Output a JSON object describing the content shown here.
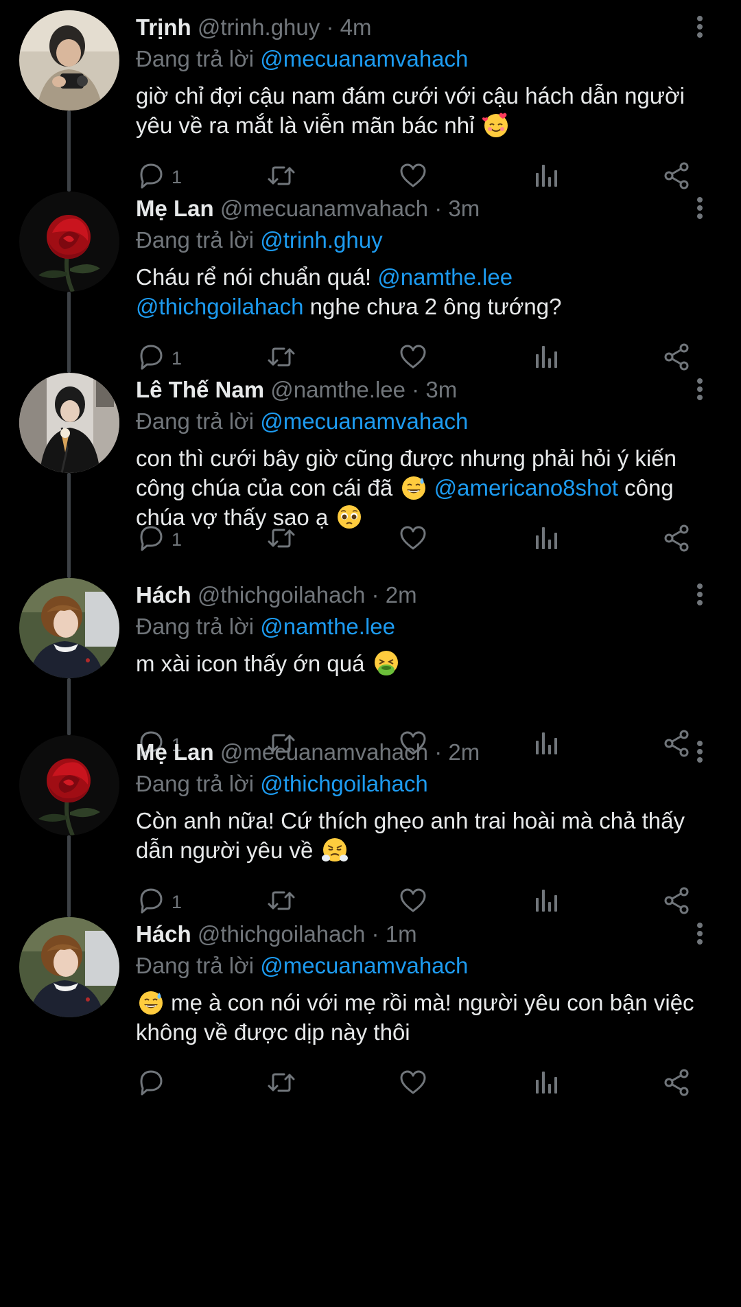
{
  "thread": [
    {
      "name": "Trịnh",
      "handle": "@trinh.ghuy",
      "time": "4m",
      "reply_prefix": "Đang trả lời",
      "reply_to": "@mecuanamvahach",
      "body_parts": [
        {
          "t": "text",
          "v": "giờ chỉ đợi cậu nam đám cưới với cậu hách dẫn người yêu về ra mắt là viễn mãn bác nhỉ "
        },
        {
          "t": "emoji",
          "v": "smiling-face-with-hearts"
        }
      ],
      "reply_count": "1",
      "avatar": "person-with-camera"
    },
    {
      "name": "Mẹ Lan",
      "handle": "@mecuanamvahach",
      "time": "3m",
      "reply_prefix": "Đang trả lời",
      "reply_to": "@trinh.ghuy",
      "body_parts": [
        {
          "t": "text",
          "v": "Cháu rể nói chuẩn quá! "
        },
        {
          "t": "mention",
          "v": "@namthe.lee"
        },
        {
          "t": "br",
          "v": ""
        },
        {
          "t": "mention",
          "v": "@thichgoilahach"
        },
        {
          "t": "text",
          "v": " nghe chưa 2 ông tướng?"
        }
      ],
      "reply_count": "1",
      "avatar": "red-rose"
    },
    {
      "name": "Lê Thế Nam",
      "handle": "@namthe.lee",
      "time": "3m",
      "reply_prefix": "Đang trả lời",
      "reply_to": "@mecuanamvahach",
      "body_parts": [
        {
          "t": "text",
          "v": "con thì cưới bây giờ cũng được nhưng phải hỏi ý kiến công chúa của con cái đã "
        },
        {
          "t": "emoji",
          "v": "grinning-sweat"
        },
        {
          "t": "text",
          "v": " "
        },
        {
          "t": "mention",
          "v": "@americano8shot"
        },
        {
          "t": "text",
          "v": " công chúa vợ thấy sao ạ "
        },
        {
          "t": "emoji",
          "v": "pleading-face"
        }
      ],
      "reply_count": "1",
      "avatar": "person-with-icecream"
    },
    {
      "name": "Hách",
      "handle": "@thichgoilahach",
      "time": "2m",
      "reply_prefix": "Đang trả lời",
      "reply_to": "@namthe.lee",
      "body_parts": [
        {
          "t": "text",
          "v": "m xài icon thấy ớn quá "
        },
        {
          "t": "emoji",
          "v": "vomiting-face"
        }
      ],
      "reply_count": "1",
      "avatar": "person-in-sweater"
    },
    {
      "name": "Mẹ Lan",
      "handle": "@mecuanamvahach",
      "time": "2m",
      "reply_prefix": "Đang trả lời",
      "reply_to": "@thichgoilahach",
      "body_parts": [
        {
          "t": "text",
          "v": "Còn anh nữa! Cứ thích ghẹo anh trai hoài mà chả thấy dẫn người yêu về "
        },
        {
          "t": "emoji",
          "v": "face-steam-nose"
        }
      ],
      "reply_count": "1",
      "avatar": "red-rose"
    },
    {
      "name": "Hách",
      "handle": "@thichgoilahach",
      "time": "1m",
      "reply_prefix": "Đang trả lời",
      "reply_to": "@mecuanamvahach",
      "body_parts": [
        {
          "t": "emoji",
          "v": "grinning-sweat"
        },
        {
          "t": "text",
          "v": " mẹ à con nói với mẹ rồi mà! người yêu con bận việc không về được dịp này thôi"
        }
      ],
      "reply_count": "",
      "avatar": "person-in-sweater"
    }
  ],
  "separator": "·",
  "colors": {
    "background": "#000000",
    "text": "#e7e9ea",
    "muted": "#71767b",
    "mention": "#1d9bf0",
    "thread_line": "#3d4146"
  }
}
